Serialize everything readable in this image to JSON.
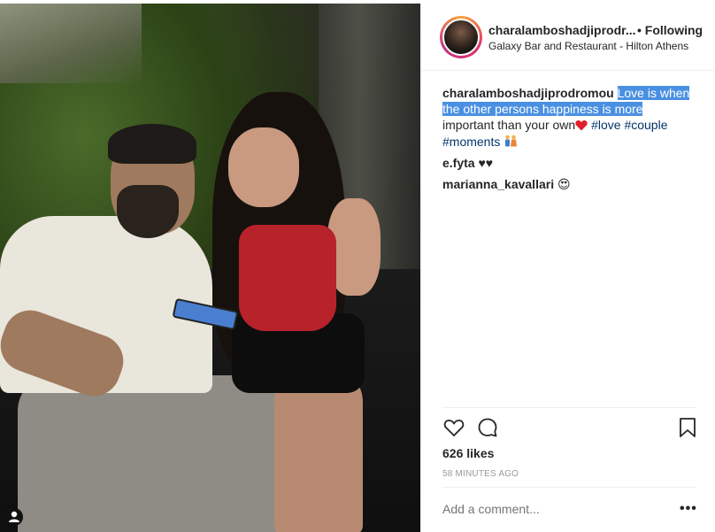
{
  "post": {
    "author": "charalamboshadjiprodr...",
    "follow_status": "• Following",
    "location": "Galaxy Bar and Restaurant - Hilton Athens"
  },
  "caption": {
    "username": "charalamboshadjiprodromou",
    "text_highlighted_1": "Love is when",
    "text_highlighted_2": "the other persons happiness is more",
    "text_plain": "important than your own",
    "hashtags": [
      "#love",
      "#couple",
      "#moments"
    ]
  },
  "comments": [
    {
      "username": "e.fyta",
      "text": "♥♥"
    },
    {
      "username": "marianna_kavallari",
      "text": "😍"
    }
  ],
  "stats": {
    "likes": "626 likes",
    "time_ago": "58 MINUTES AGO"
  },
  "comment_input": {
    "placeholder": "Add a comment..."
  },
  "more_options": "•••",
  "icons": {
    "like": "heart-icon",
    "comment": "comment-bubble-icon",
    "save": "bookmark-icon",
    "user_tag": "person-icon"
  },
  "colors": {
    "highlight": "#4a90e2",
    "hashtag": "#003569",
    "muted": "#999999"
  }
}
